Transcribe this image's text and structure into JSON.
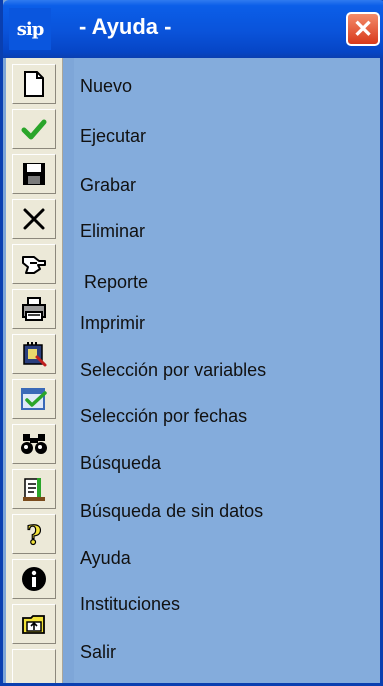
{
  "window": {
    "app_logo": "sip",
    "title": "- Ayuda -",
    "close_label": "✕"
  },
  "items": [
    {
      "label": "Nuevo",
      "icon": "new-document-icon"
    },
    {
      "label": "Ejecutar",
      "icon": "checkmark-icon"
    },
    {
      "label": "Grabar",
      "icon": "floppy-disk-icon"
    },
    {
      "label": "Eliminar",
      "icon": "delete-x-icon"
    },
    {
      "label": "Reporte",
      "icon": "report-hand-icon"
    },
    {
      "label": "Imprimir",
      "icon": "printer-icon"
    },
    {
      "label": "Selección por variables",
      "icon": "variables-filter-icon"
    },
    {
      "label": "Selección por fechas",
      "icon": "calendar-check-icon"
    },
    {
      "label": "Búsqueda",
      "icon": "binoculars-icon"
    },
    {
      "label": "Búsqueda de sin datos",
      "icon": "empty-search-icon"
    },
    {
      "label": "Ayuda",
      "icon": "question-icon"
    },
    {
      "label": "Instituciones",
      "icon": "info-icon"
    },
    {
      "label": "Salir",
      "icon": "exit-folder-icon"
    }
  ],
  "colors": {
    "titlebar": "#0a53da",
    "panel": "#84acdc",
    "toolbar": "#ece9d8"
  }
}
